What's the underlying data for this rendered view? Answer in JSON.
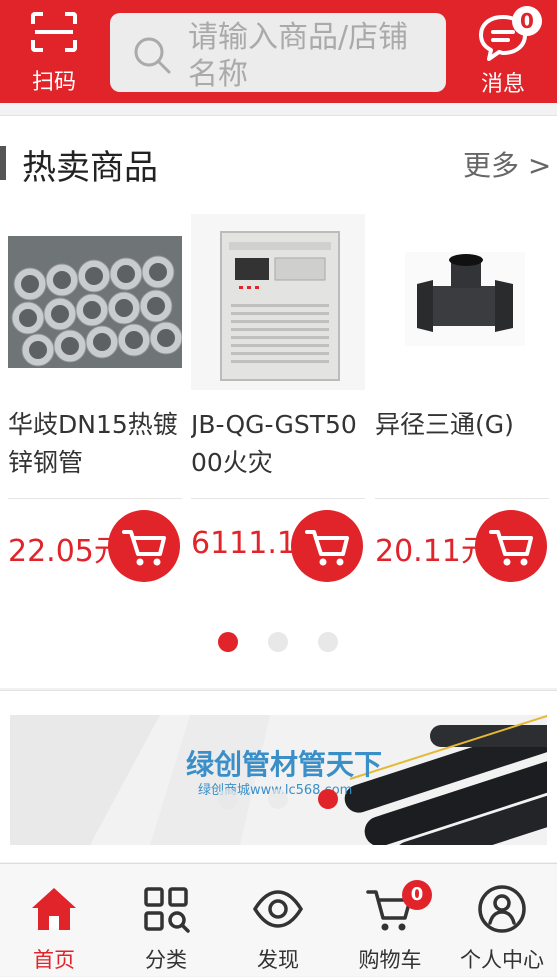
{
  "header": {
    "scan_label": "扫码",
    "search_placeholder": "请输入商品/店铺名称",
    "message_label": "消息",
    "message_count": "0"
  },
  "hot": {
    "title": "热卖商品",
    "more": "更多 >",
    "products": [
      {
        "name": "华歧DN15热镀锌钢管",
        "price": "22.05元"
      },
      {
        "name": "JB-QG-GST5000火灾",
        "price": "6111.1"
      },
      {
        "name": "异径三通(G)",
        "price": "20.11元"
      }
    ],
    "page_count": 3,
    "active_page": 1
  },
  "banner": {
    "title": "绿创管材管天下",
    "subtitle": "绿创商城www.lc568.com",
    "slide_count": 3,
    "active_slide": 3
  },
  "nav": {
    "items": [
      {
        "label": "首页",
        "icon": "home-icon"
      },
      {
        "label": "分类",
        "icon": "category-icon"
      },
      {
        "label": "发现",
        "icon": "eye-icon"
      },
      {
        "label": "购物车",
        "icon": "cart-icon"
      },
      {
        "label": "个人中心",
        "icon": "user-icon"
      }
    ],
    "cart_count": "0"
  },
  "colors": {
    "brand": "#e0242a"
  }
}
